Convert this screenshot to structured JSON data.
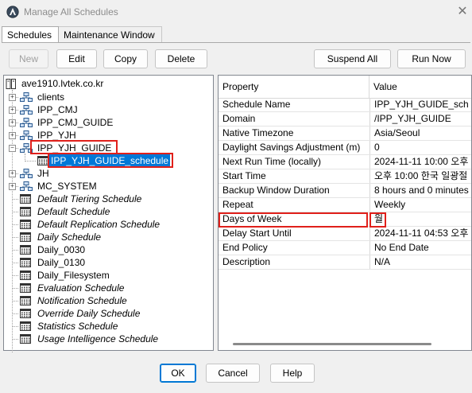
{
  "window": {
    "title": "Manage All Schedules",
    "close_glyph": "✕"
  },
  "tabs": [
    {
      "label": "Schedules",
      "active": true
    },
    {
      "label": "Maintenance Window",
      "active": false
    }
  ],
  "toolbar": {
    "new_label": "New",
    "edit_label": "Edit",
    "copy_label": "Copy",
    "delete_label": "Delete",
    "suspend_all_label": "Suspend All",
    "run_now_label": "Run Now"
  },
  "tree": {
    "root": "ave1910.lvtek.co.kr",
    "items": [
      {
        "label": "clients",
        "type": "group",
        "expander": "+"
      },
      {
        "label": "IPP_CMJ",
        "type": "group",
        "expander": "+"
      },
      {
        "label": "IPP_CMJ_GUIDE",
        "type": "group",
        "expander": "+"
      },
      {
        "label": "IPP_YJH",
        "type": "group",
        "expander": "+"
      },
      {
        "label": "IPP_YJH_GUIDE",
        "type": "group",
        "expander": "−"
      },
      {
        "label": "IPP_YJH_GUIDE_schedule",
        "type": "schedule-selected"
      },
      {
        "label": "JH",
        "type": "group",
        "expander": "+"
      },
      {
        "label": "MC_SYSTEM",
        "type": "group",
        "expander": "+"
      },
      {
        "label": "Default Tiering Schedule",
        "type": "schedule-italic"
      },
      {
        "label": "Default Schedule",
        "type": "schedule-italic"
      },
      {
        "label": "Default Replication Schedule",
        "type": "schedule-italic"
      },
      {
        "label": "Daily Schedule",
        "type": "schedule-italic"
      },
      {
        "label": "Daily_0030",
        "type": "schedule"
      },
      {
        "label": "Daily_0130",
        "type": "schedule"
      },
      {
        "label": "Daily_Filesystem",
        "type": "schedule"
      },
      {
        "label": "Evaluation Schedule",
        "type": "schedule-italic"
      },
      {
        "label": "Notification Schedule",
        "type": "schedule-italic"
      },
      {
        "label": "Override Daily Schedule",
        "type": "schedule-italic"
      },
      {
        "label": "Statistics Schedule",
        "type": "schedule-italic"
      },
      {
        "label": "Usage Intelligence Schedule",
        "type": "schedule-italic"
      }
    ]
  },
  "properties": {
    "header_property": "Property",
    "header_value": "Value",
    "rows": [
      {
        "property": "Schedule Name",
        "value": "IPP_YJH_GUIDE_sch"
      },
      {
        "property": "Domain",
        "value": "/IPP_YJH_GUIDE"
      },
      {
        "property": "Native Timezone",
        "value": "Asia/Seoul"
      },
      {
        "property": "Daylight Savings Adjustment (m)",
        "value": "0"
      },
      {
        "property": "Next Run Time (locally)",
        "value": "2024-11-11 10:00 오후"
      },
      {
        "property": "Start Time",
        "value": "오후 10:00 한국 일광절"
      },
      {
        "property": "Backup Window Duration",
        "value": "8 hours and 0 minutes"
      },
      {
        "property": "Repeat",
        "value": "Weekly"
      },
      {
        "property": "Days of Week",
        "value": "월"
      },
      {
        "property": "Delay Start Until",
        "value": "2024-11-11 04:53 오후"
      },
      {
        "property": "End Policy",
        "value": "No End Date"
      },
      {
        "property": "Description",
        "value": "N/A"
      }
    ]
  },
  "dialog_buttons": {
    "ok_label": "OK",
    "cancel_label": "Cancel",
    "help_label": "Help"
  },
  "colors": {
    "selection": "#0078d7",
    "annotation": "#e0201b"
  }
}
